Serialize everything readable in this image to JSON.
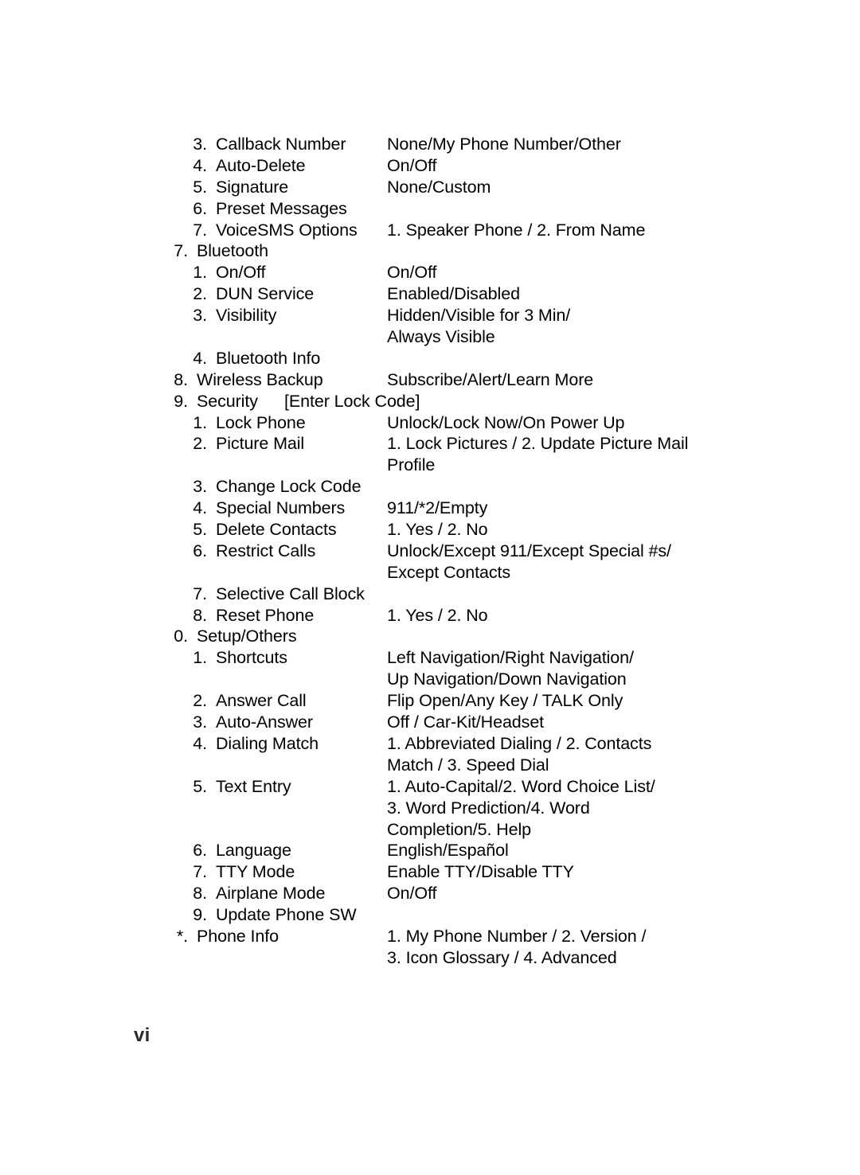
{
  "document": {
    "page_number": "vi",
    "rows": [
      {
        "level": 2,
        "marker": "3.",
        "label": "Callback Number",
        "value": "None/My Phone Number/Other",
        "value_style": "col"
      },
      {
        "level": 2,
        "marker": "4.",
        "label": "Auto-Delete",
        "value": "On/Off",
        "value_style": "col"
      },
      {
        "level": 2,
        "marker": "5.",
        "label": "Signature",
        "value": "None/Custom",
        "value_style": "col"
      },
      {
        "level": 2,
        "marker": "6.",
        "label": "Preset Messages",
        "value": "",
        "value_style": "col"
      },
      {
        "level": 2,
        "marker": "7.",
        "label": "VoiceSMS Options",
        "value": "1. Speaker Phone / 2. From Name",
        "value_style": "col"
      },
      {
        "level": 1,
        "marker": "7.",
        "label": "Bluetooth",
        "value": "",
        "value_style": "col"
      },
      {
        "level": 2,
        "marker": "1.",
        "label": "On/Off",
        "value": "On/Off",
        "value_style": "col"
      },
      {
        "level": 2,
        "marker": "2.",
        "label": "DUN Service",
        "value": "Enabled/Disabled",
        "value_style": "col"
      },
      {
        "level": 2,
        "marker": "3.",
        "label": "Visibility",
        "value": "Hidden/Visible for 3 Min/",
        "value_style": "col"
      },
      {
        "level": 2,
        "marker": "",
        "label": "",
        "value": "Always Visible",
        "value_style": "cont"
      },
      {
        "level": 2,
        "marker": "4.",
        "label": "Bluetooth Info",
        "value": "",
        "value_style": "col"
      },
      {
        "level": 1,
        "marker": "8.",
        "label": "Wireless Backup",
        "value": "Subscribe/Alert/Learn More",
        "value_style": "col"
      },
      {
        "level": 1,
        "marker": "9.",
        "label": "Security",
        "value": "[Enter Lock Code]",
        "value_style": "inline"
      },
      {
        "level": 2,
        "marker": "1.",
        "label": "Lock Phone",
        "value": "Unlock/Lock Now/On Power Up",
        "value_style": "col"
      },
      {
        "level": 2,
        "marker": "2.",
        "label": "Picture Mail",
        "value": "1. Lock Pictures / 2. Update Picture Mail",
        "value_style": "col"
      },
      {
        "level": 2,
        "marker": "",
        "label": "",
        "value": "Profile",
        "value_style": "cont"
      },
      {
        "level": 2,
        "marker": "3.",
        "label": "Change Lock Code",
        "value": "",
        "value_style": "col"
      },
      {
        "level": 2,
        "marker": "4.",
        "label": "Special Numbers",
        "value": "911/*2/Empty",
        "value_style": "col"
      },
      {
        "level": 2,
        "marker": "5.",
        "label": "Delete Contacts",
        "value": "1. Yes / 2. No",
        "value_style": "col"
      },
      {
        "level": 2,
        "marker": "6.",
        "label": "Restrict Calls",
        "value": "Unlock/Except 911/Except Special #s/",
        "value_style": "col"
      },
      {
        "level": 2,
        "marker": "",
        "label": "",
        "value": "Except Contacts",
        "value_style": "cont"
      },
      {
        "level": 2,
        "marker": "7.",
        "label": "Selective Call Block",
        "value": "",
        "value_style": "col"
      },
      {
        "level": 2,
        "marker": "8.",
        "label": "Reset Phone",
        "value": "1. Yes / 2. No",
        "value_style": "col"
      },
      {
        "level": 1,
        "marker": "0.",
        "label": "Setup/Others",
        "value": "",
        "value_style": "col"
      },
      {
        "level": 2,
        "marker": "1.",
        "label": "Shortcuts",
        "value": "Left Navigation/Right Navigation/",
        "value_style": "col"
      },
      {
        "level": 2,
        "marker": "",
        "label": "",
        "value": "Up Navigation/Down Navigation",
        "value_style": "cont"
      },
      {
        "level": 2,
        "marker": "2.",
        "label": "Answer Call",
        "value": "Flip Open/Any Key / TALK Only",
        "value_style": "col"
      },
      {
        "level": 2,
        "marker": "3.",
        "label": "Auto-Answer",
        "value": "Off / Car-Kit/Headset",
        "value_style": "col"
      },
      {
        "level": 2,
        "marker": "4.",
        "label": "Dialing Match",
        "value": "1. Abbreviated Dialing / 2. Contacts",
        "value_style": "col"
      },
      {
        "level": 2,
        "marker": "",
        "label": "",
        "value": "Match / 3. Speed Dial",
        "value_style": "cont"
      },
      {
        "level": 2,
        "marker": "5.",
        "label": "Text Entry",
        "value": "1. Auto-Capital/2. Word Choice List/",
        "value_style": "col"
      },
      {
        "level": 2,
        "marker": "",
        "label": "",
        "value": "3. Word Prediction/4. Word",
        "value_style": "cont"
      },
      {
        "level": 2,
        "marker": "",
        "label": "",
        "value": "Completion/5. Help",
        "value_style": "cont"
      },
      {
        "level": 2,
        "marker": "6.",
        "label": "Language",
        "value": "English/Español",
        "value_style": "col"
      },
      {
        "level": 2,
        "marker": "7.",
        "label": "TTY Mode",
        "value": "Enable TTY/Disable TTY",
        "value_style": "col"
      },
      {
        "level": 2,
        "marker": "8.",
        "label": "Airplane Mode",
        "value": "On/Off",
        "value_style": "col"
      },
      {
        "level": 2,
        "marker": "9.",
        "label": "Update Phone SW",
        "value": "",
        "value_style": "col"
      },
      {
        "level": 1,
        "marker": "*.",
        "label": "Phone Info",
        "value": "1. My Phone Number / 2. Version /",
        "value_style": "col"
      },
      {
        "level": 2,
        "marker": "",
        "label": "",
        "value": "3. Icon Glossary / 4. Advanced",
        "value_style": "cont"
      }
    ]
  }
}
